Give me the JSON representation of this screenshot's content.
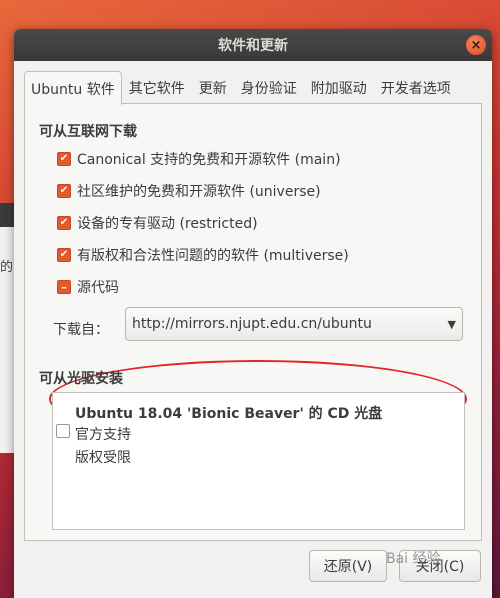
{
  "background": {
    "fragment_text": "的"
  },
  "window": {
    "title": "软件和更新",
    "close_glyph": "×"
  },
  "tabs": [
    {
      "label": "Ubuntu 软件",
      "active": true
    },
    {
      "label": "其它软件"
    },
    {
      "label": "更新"
    },
    {
      "label": "身份验证"
    },
    {
      "label": "附加驱动"
    },
    {
      "label": "开发者选项"
    }
  ],
  "internet": {
    "heading": "可从互联网下载",
    "items": [
      {
        "label": "Canonical 支持的免费和开源软件 (main)",
        "state": "checked"
      },
      {
        "label": "社区维护的免费和开源软件 (universe)",
        "state": "checked"
      },
      {
        "label": "设备的专有驱动 (restricted)",
        "state": "checked"
      },
      {
        "label": "有版权和合法性问题的的软件 (multiverse)",
        "state": "checked"
      },
      {
        "label": "源代码",
        "state": "partial"
      }
    ],
    "download_from_label": "下载自：",
    "download_from_value": "http://mirrors.njupt.edu.cn/ubuntu"
  },
  "cdrom": {
    "heading": "可从光驱安装",
    "title": "Ubuntu 18.04 'Bionic Beaver' 的 CD 光盘",
    "lines": [
      "官方支持",
      "版权受限"
    ]
  },
  "buttons": {
    "revert": "还原(V)",
    "close": "关闭(C)"
  },
  "watermark": "Bai 经验",
  "colors": {
    "accent": "#e05a2b",
    "annotation": "#e2252b",
    "titlebar": "#3c3c3c"
  }
}
